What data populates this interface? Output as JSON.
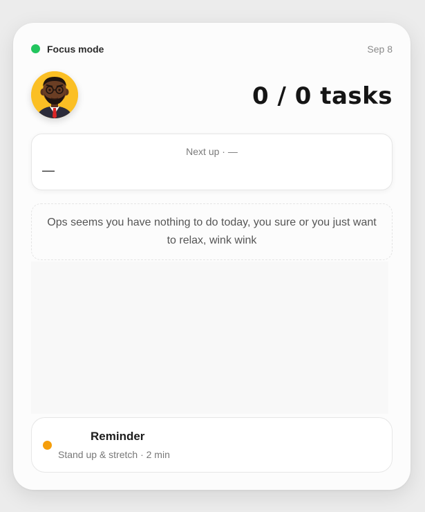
{
  "header": {
    "status_label": "Focus mode",
    "status_color": "#22c55e",
    "date": "Sep 8"
  },
  "summary": {
    "tasks_text": "0 / 0 tasks"
  },
  "next_up": {
    "label": "Next up · —",
    "value": "—"
  },
  "empty_state": {
    "message": "Ops seems you have nothing to do today, you sure or you just want to relax, wink wink"
  },
  "reminder": {
    "title": "Reminder",
    "subtitle": "Stand up & stretch · 2 min",
    "dot_color": "#f59e0b"
  }
}
